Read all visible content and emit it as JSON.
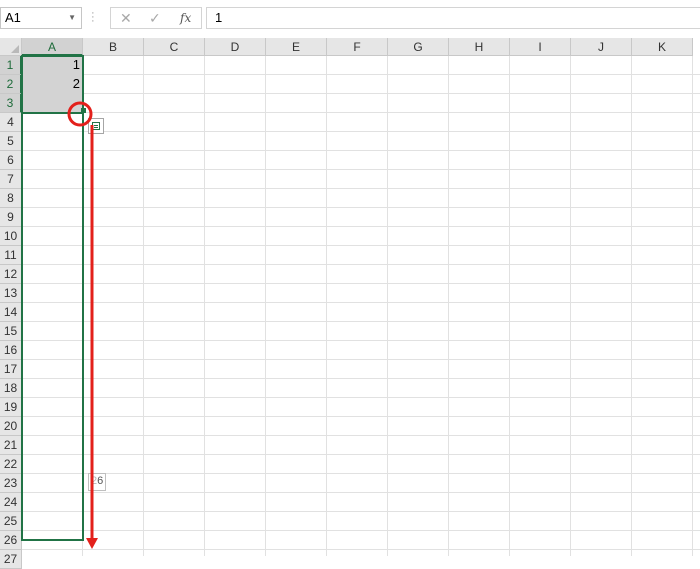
{
  "formula_bar": {
    "name_box": "A1",
    "cancel_glyph": "✕",
    "enter_glyph": "✓",
    "fx_label": "fx",
    "formula_value": "1"
  },
  "columns": [
    "A",
    "B",
    "C",
    "D",
    "E",
    "F",
    "G",
    "H",
    "I",
    "J",
    "K"
  ],
  "rows": [
    "1",
    "2",
    "3",
    "4",
    "5",
    "6",
    "7",
    "8",
    "9",
    "10",
    "11",
    "12",
    "13",
    "14",
    "15",
    "16",
    "17",
    "18",
    "19",
    "20",
    "21",
    "22",
    "23",
    "24",
    "25",
    "26",
    "27"
  ],
  "cells": {
    "A1": "1",
    "A2": "2",
    "A3": ""
  },
  "drag_tooltip": {
    "prefix": "2",
    "value": "6"
  },
  "annotations": {
    "arrow_color": "#e3201b",
    "circle_color": "#e3201b"
  },
  "colors": {
    "selection_accent": "#217346",
    "selected_fill": "#d3d3d3"
  }
}
